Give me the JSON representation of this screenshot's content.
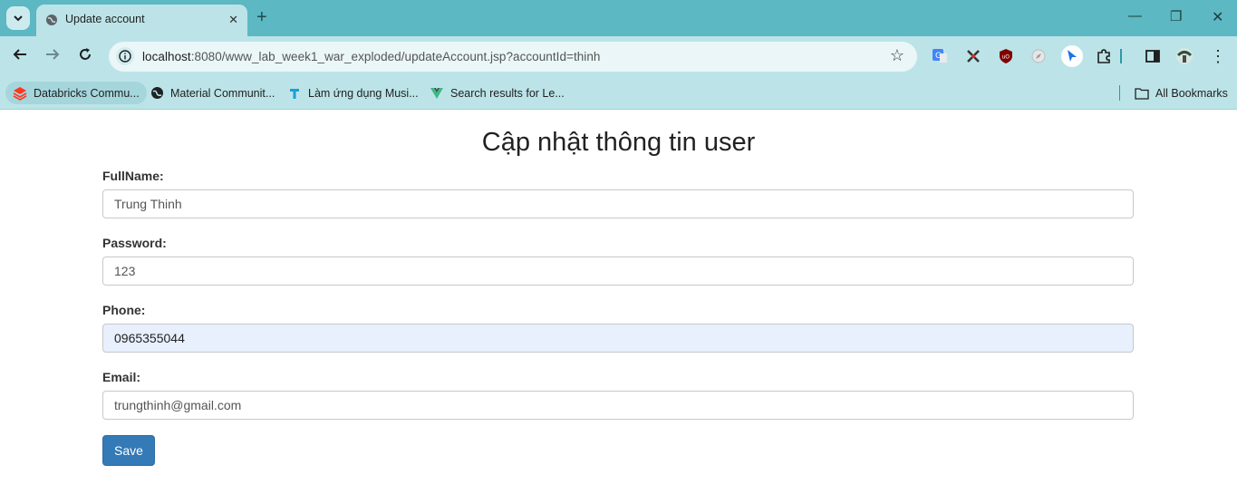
{
  "browser": {
    "tab_title": "Update account",
    "url_host": "localhost",
    "url_rest": ":8080/www_lab_week1_war_exploded/updateAccount.jsp?accountId=thinh",
    "bookmarks": [
      {
        "label": "Databricks Commu...",
        "icon": "databricks-icon"
      },
      {
        "label": "Material Communit...",
        "icon": "globe-icon"
      },
      {
        "label": "Làm ứng dụng Musi...",
        "icon": "t-icon"
      },
      {
        "label": "Search results for Le...",
        "icon": "vue-icon"
      }
    ],
    "all_bookmarks_label": "All Bookmarks"
  },
  "page": {
    "title": "Cập nhật thông tin user",
    "fields": {
      "fullname": {
        "label": "FullName:",
        "value": "Trung Thinh"
      },
      "password": {
        "label": "Password:",
        "value": "123"
      },
      "phone": {
        "label": "Phone:",
        "value": "0965355044"
      },
      "email": {
        "label": "Email:",
        "value": "trungthinh@gmail.com"
      }
    },
    "save_label": "Save"
  },
  "colors": {
    "chrome": "#5cb8c2",
    "toolbar": "#bce4e8",
    "save_button": "#337ab7",
    "autofill": "#e8f0fe"
  }
}
